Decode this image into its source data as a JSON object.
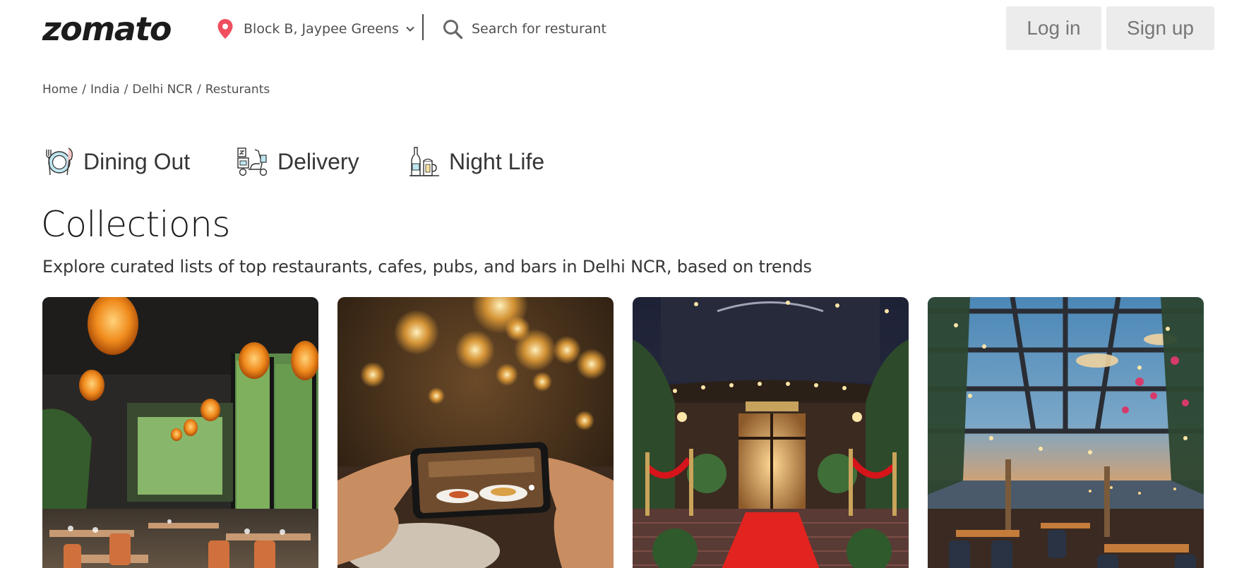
{
  "header": {
    "logo_text": "zomato",
    "location": "Block B, Jaypee Greens",
    "search_placeholder": "Search for resturant",
    "login_label": "Log in",
    "signup_label": "Sign up",
    "pin_color": "#ef4f5f"
  },
  "breadcrumb": {
    "items": [
      "Home",
      "India",
      "Delhi NCR",
      "Resturants"
    ],
    "separator": "/"
  },
  "tabs": [
    {
      "label": "Dining Out",
      "icon": "dining-out-icon"
    },
    {
      "label": "Delivery",
      "icon": "delivery-scooter-icon"
    },
    {
      "label": "Night Life",
      "icon": "night-life-bottle-icon"
    }
  ],
  "collections": {
    "title": "Collections",
    "subtitle": "Explore curated lists of top restaurants, cafes, pubs, and bars in Delhi NCR, based on trends",
    "cards": [
      {
        "image": "restaurant-interior-lanterns-image"
      },
      {
        "image": "phone-photographing-food-image"
      },
      {
        "image": "restaurant-entrance-red-carpet-image"
      },
      {
        "image": "rooftop-dining-sunset-image"
      }
    ]
  }
}
